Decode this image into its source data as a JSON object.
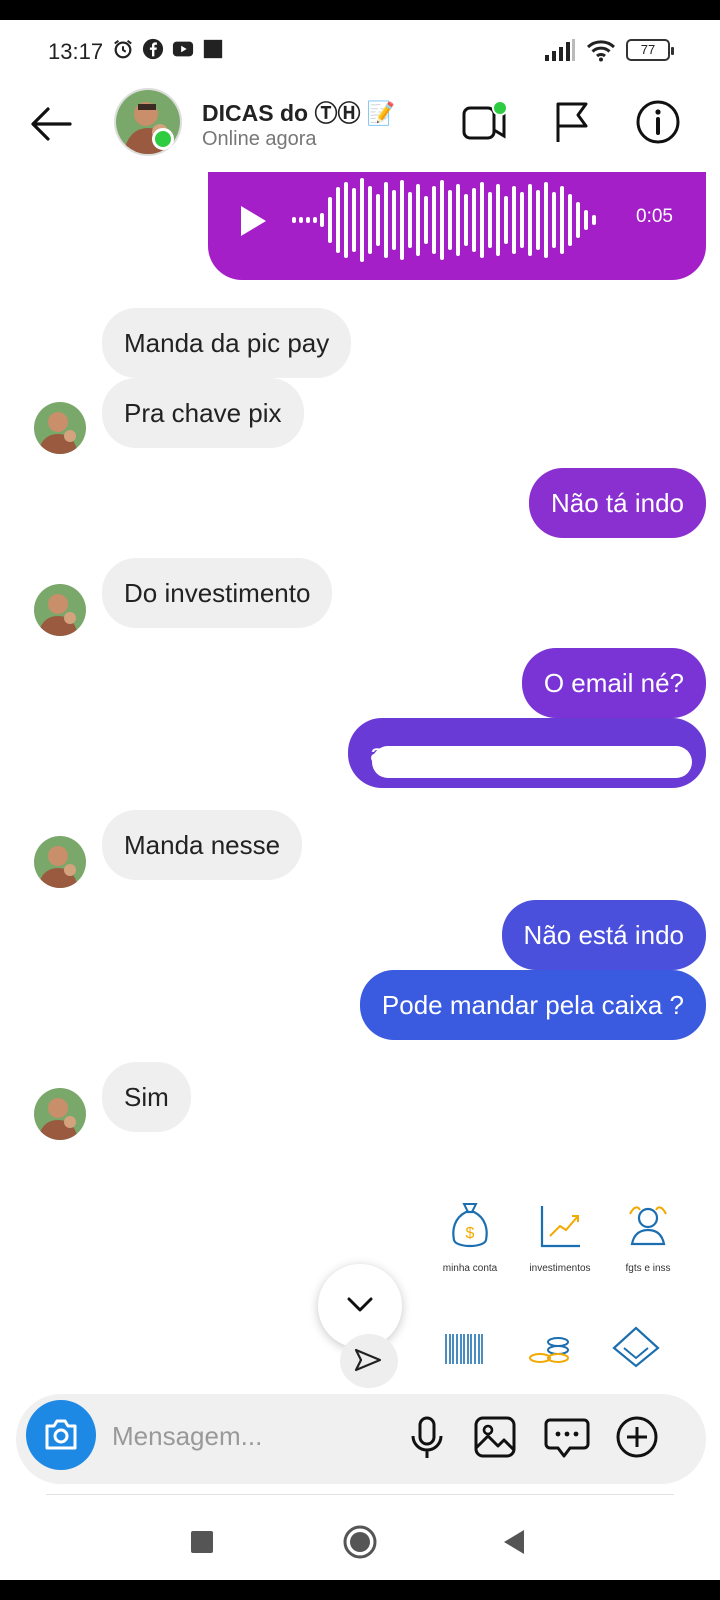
{
  "status_bar": {
    "time": "13:17",
    "battery": "77"
  },
  "header": {
    "contact_name": "DICAS do ⓉⒽ 📝",
    "status": "Online agora"
  },
  "voice_message": {
    "duration": "0:05"
  },
  "messages": [
    {
      "dir": "in",
      "text": "Manda da pic pay"
    },
    {
      "dir": "in",
      "text": "Pra chave pix"
    },
    {
      "dir": "out",
      "text": "Não tá indo"
    },
    {
      "dir": "in",
      "text": "Do investimento"
    },
    {
      "dir": "out",
      "text": "O email né?"
    },
    {
      "dir": "out",
      "text": "a"
    },
    {
      "dir": "in",
      "text": "Manda nesse"
    },
    {
      "dir": "out",
      "text": "Não está indo"
    },
    {
      "dir": "out",
      "text": "Pode mandar pela caixa ?"
    },
    {
      "dir": "in",
      "text": "Sim"
    }
  ],
  "apps": {
    "minha_conta": "minha conta",
    "investimentos": "investimentos",
    "fgts": "fgts e inss"
  },
  "composer": {
    "placeholder": "Mensagem..."
  },
  "colors": {
    "voice_bubble": "#a51fc9",
    "out_purple": "#8a2fd0",
    "out_violet": "#6a3ad6",
    "out_blue": "#3a5ae0",
    "online_green": "#2ecc40",
    "camera_blue": "#1e88e5"
  }
}
